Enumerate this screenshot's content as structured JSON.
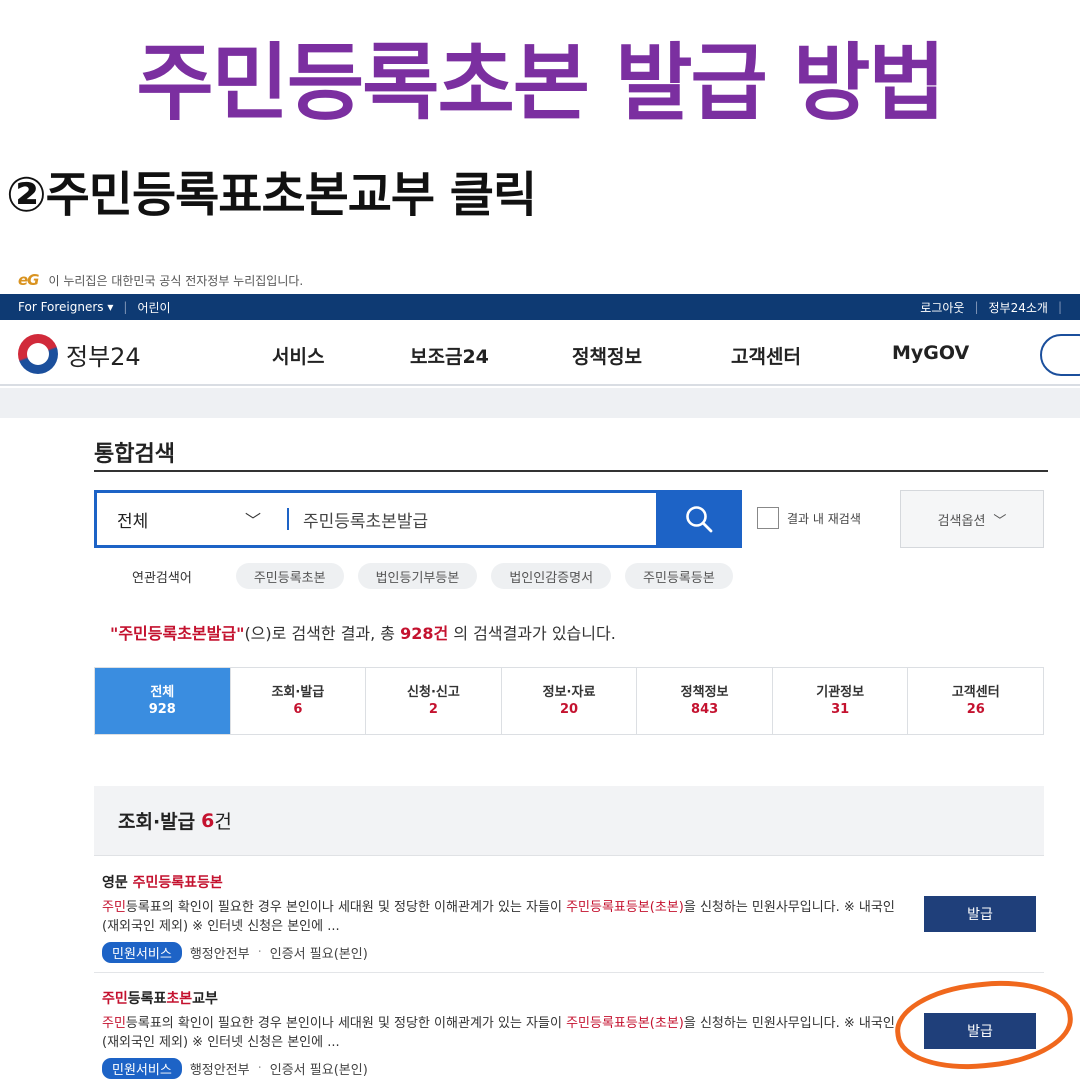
{
  "overlay": {
    "main_title": "주민등록초본 발급 방법",
    "step_title": "②주민등록표초본교부 클릭"
  },
  "notice": {
    "logo_text": "eG",
    "text": "이 누리집은 대한민국 공식 전자정부 누리집입니다."
  },
  "topbar": {
    "foreigners": "For Foreigners ▾",
    "kids": "어린이",
    "logout": "로그아웃",
    "about": "정부24소개"
  },
  "gnb": {
    "logo": "정부24",
    "items": [
      "서비스",
      "보조금24",
      "정책정보",
      "고객센터",
      "MyGOV"
    ]
  },
  "search": {
    "heading": "통합검색",
    "scope": "전체",
    "query": "주민등록초본발급",
    "recheck_label": "결과 내 재검색",
    "option_label": "검색옵션",
    "related_label": "연관검색어",
    "related": [
      "주민등록초본",
      "법인등기부등본",
      "법인인감증명서",
      "주민등록등본"
    ]
  },
  "summary": {
    "query": "\"주민등록초본발급\"",
    "text_1": "(으)로 검색한 결과, 총 ",
    "count": "928건",
    "text_2": " 의 검색결과가 있습니다."
  },
  "tabs": [
    {
      "label": "전체",
      "count": "928"
    },
    {
      "label": "조회·발급",
      "count": "6"
    },
    {
      "label": "신청·신고",
      "count": "2"
    },
    {
      "label": "정보·자료",
      "count": "20"
    },
    {
      "label": "정책정보",
      "count": "843"
    },
    {
      "label": "기관정보",
      "count": "31"
    },
    {
      "label": "고객센터",
      "count": "26"
    }
  ],
  "section": {
    "title": "조회·발급",
    "count": "6",
    "unit": "건"
  },
  "results": [
    {
      "title_a": "영문 ",
      "title_b": "주민등록표등본",
      "title_c": "",
      "desc_a": "주민",
      "desc_b": "등록표의 확인이 필요한 경우 본인이나 세대원 및 정당한 이해관계가 있는 자들이 ",
      "desc_c": "주민등록표등본(초본)",
      "desc_d": "을 신청하는 민원사무입니다. ※ 내국인(재외국인 제외) ※ 인터넷 신청은 본인에 ...",
      "tag": "민원서비스",
      "org": "행정안전부",
      "cert": "인증서 필요(본인)",
      "button": "발급"
    },
    {
      "title_a": "주민",
      "title_b": "등록표",
      "title_c": "초본",
      "title_d": "교부",
      "desc_a": "주민",
      "desc_b": "등록표의 확인이 필요한 경우 본인이나 세대원 및 정당한 이해관계가 있는 자들이 ",
      "desc_c": "주민등록표등본(초본)",
      "desc_d": "을 신청하는 민원사무입니다. ※ 내국인(재외국인 제외) ※ 인터넷 신청은 본인에 ...",
      "tag": "민원서비스",
      "org": "행정안전부",
      "cert": "인증서 필요(본인)",
      "button": "발급"
    }
  ],
  "colors": {
    "title_purple": "#7b2fa0",
    "navy": "#0e3a73",
    "search_blue": "#1d63c6",
    "highlight_red": "#c4122f",
    "annotation_orange": "#f0681d",
    "issue_button": "#1f3f7a"
  }
}
